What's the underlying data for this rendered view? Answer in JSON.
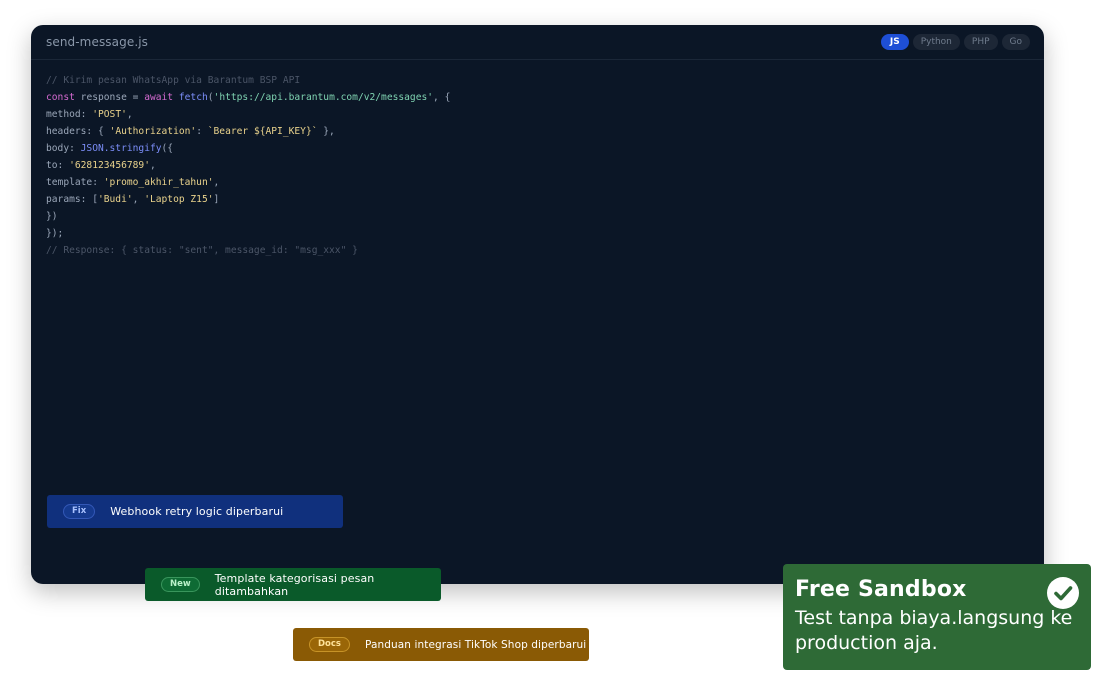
{
  "code_window": {
    "file_name": "send-message.js",
    "tabs": [
      "JS",
      "Python",
      "PHP",
      "Go"
    ],
    "active_tab": "JS",
    "lines": [
      [
        {
          "t": "// Kirim pesan WhatsApp via Barantum BSP API",
          "c": "com"
        }
      ],
      [
        {
          "t": "const",
          "c": "kw"
        },
        {
          "t": " response = ",
          "c": ""
        },
        {
          "t": "await",
          "c": "kw"
        },
        {
          "t": " ",
          "c": ""
        },
        {
          "t": "fetch",
          "c": "fn"
        },
        {
          "t": "(",
          "c": ""
        },
        {
          "t": "'https://api.barantum.com/v2/messages'",
          "c": "url"
        },
        {
          "t": ", {",
          "c": ""
        }
      ],
      [
        {
          "t": "method: ",
          "c": ""
        },
        {
          "t": "'POST'",
          "c": "str"
        },
        {
          "t": ",",
          "c": ""
        }
      ],
      [
        {
          "t": "headers: { ",
          "c": ""
        },
        {
          "t": "'Authorization'",
          "c": "str"
        },
        {
          "t": ": ",
          "c": ""
        },
        {
          "t": "`Bearer ${API_KEY}`",
          "c": "str"
        },
        {
          "t": " },",
          "c": ""
        }
      ],
      [
        {
          "t": "body: ",
          "c": ""
        },
        {
          "t": "JSON.stringify",
          "c": "fn"
        },
        {
          "t": "({",
          "c": ""
        }
      ],
      [
        {
          "t": "to: ",
          "c": ""
        },
        {
          "t": "'628123456789'",
          "c": "str"
        },
        {
          "t": ",",
          "c": ""
        }
      ],
      [
        {
          "t": "template: ",
          "c": ""
        },
        {
          "t": "'promo_akhir_tahun'",
          "c": "str"
        },
        {
          "t": ",",
          "c": ""
        }
      ],
      [
        {
          "t": "params: [",
          "c": ""
        },
        {
          "t": "'Budi'",
          "c": "str"
        },
        {
          "t": ", ",
          "c": ""
        },
        {
          "t": "'Laptop Z15'",
          "c": "str"
        },
        {
          "t": "]",
          "c": ""
        }
      ],
      [
        {
          "t": "})",
          "c": ""
        }
      ],
      [
        {
          "t": "});",
          "c": ""
        }
      ],
      [
        {
          "t": "// Response: { status: \"sent\", message_id: \"msg_xxx\" }",
          "c": "com"
        }
      ]
    ]
  },
  "changelog": {
    "fix": {
      "tag": "Fix",
      "text": "Webhook retry logic diperbarui"
    },
    "new": {
      "tag": "New",
      "text": "Template kategorisasi pesan ditambahkan"
    },
    "docs": {
      "tag": "Docs",
      "text": "Panduan integrasi TikTok Shop diperbarui"
    }
  },
  "sandbox": {
    "title": "Free Sandbox",
    "description": "Test tanpa biaya.langsung ke production aja.",
    "icon": "check-circle-icon"
  },
  "colors": {
    "code_bg": "#0b1626",
    "accent_blue": "#1e4fd6",
    "fix_bg": "#10307d",
    "new_bg": "#0a5a2a",
    "docs_bg": "#8a5a05",
    "sandbox_bg": "#2e6a36"
  }
}
